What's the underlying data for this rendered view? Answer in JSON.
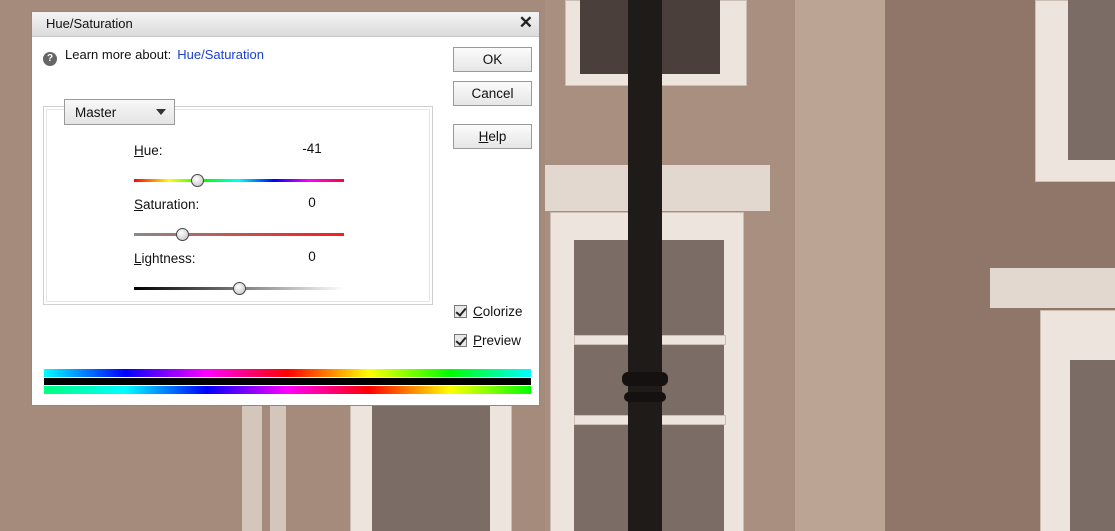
{
  "dialog": {
    "title": "Hue/Saturation",
    "learn_more_prefix": "Learn more about:",
    "learn_more_link": "Hue/Saturation",
    "buttons": {
      "ok": "OK",
      "cancel": "Cancel",
      "help": "Help"
    },
    "channel": "Master",
    "sliders": {
      "hue": {
        "label": "Hue:",
        "value": "-41",
        "position": 0.3
      },
      "saturation": {
        "label": "Saturation:",
        "value": "0",
        "position": 0.23
      },
      "lightness": {
        "label": "Lightness:",
        "value": "0",
        "position": 0.5
      }
    },
    "colorize": {
      "label": "Colorize",
      "checked": true
    },
    "preview": {
      "label": "Preview",
      "checked": true
    }
  },
  "icons": {
    "help": "question-circle-icon",
    "close": "close-icon",
    "dropdown": "chevron-down-icon"
  }
}
